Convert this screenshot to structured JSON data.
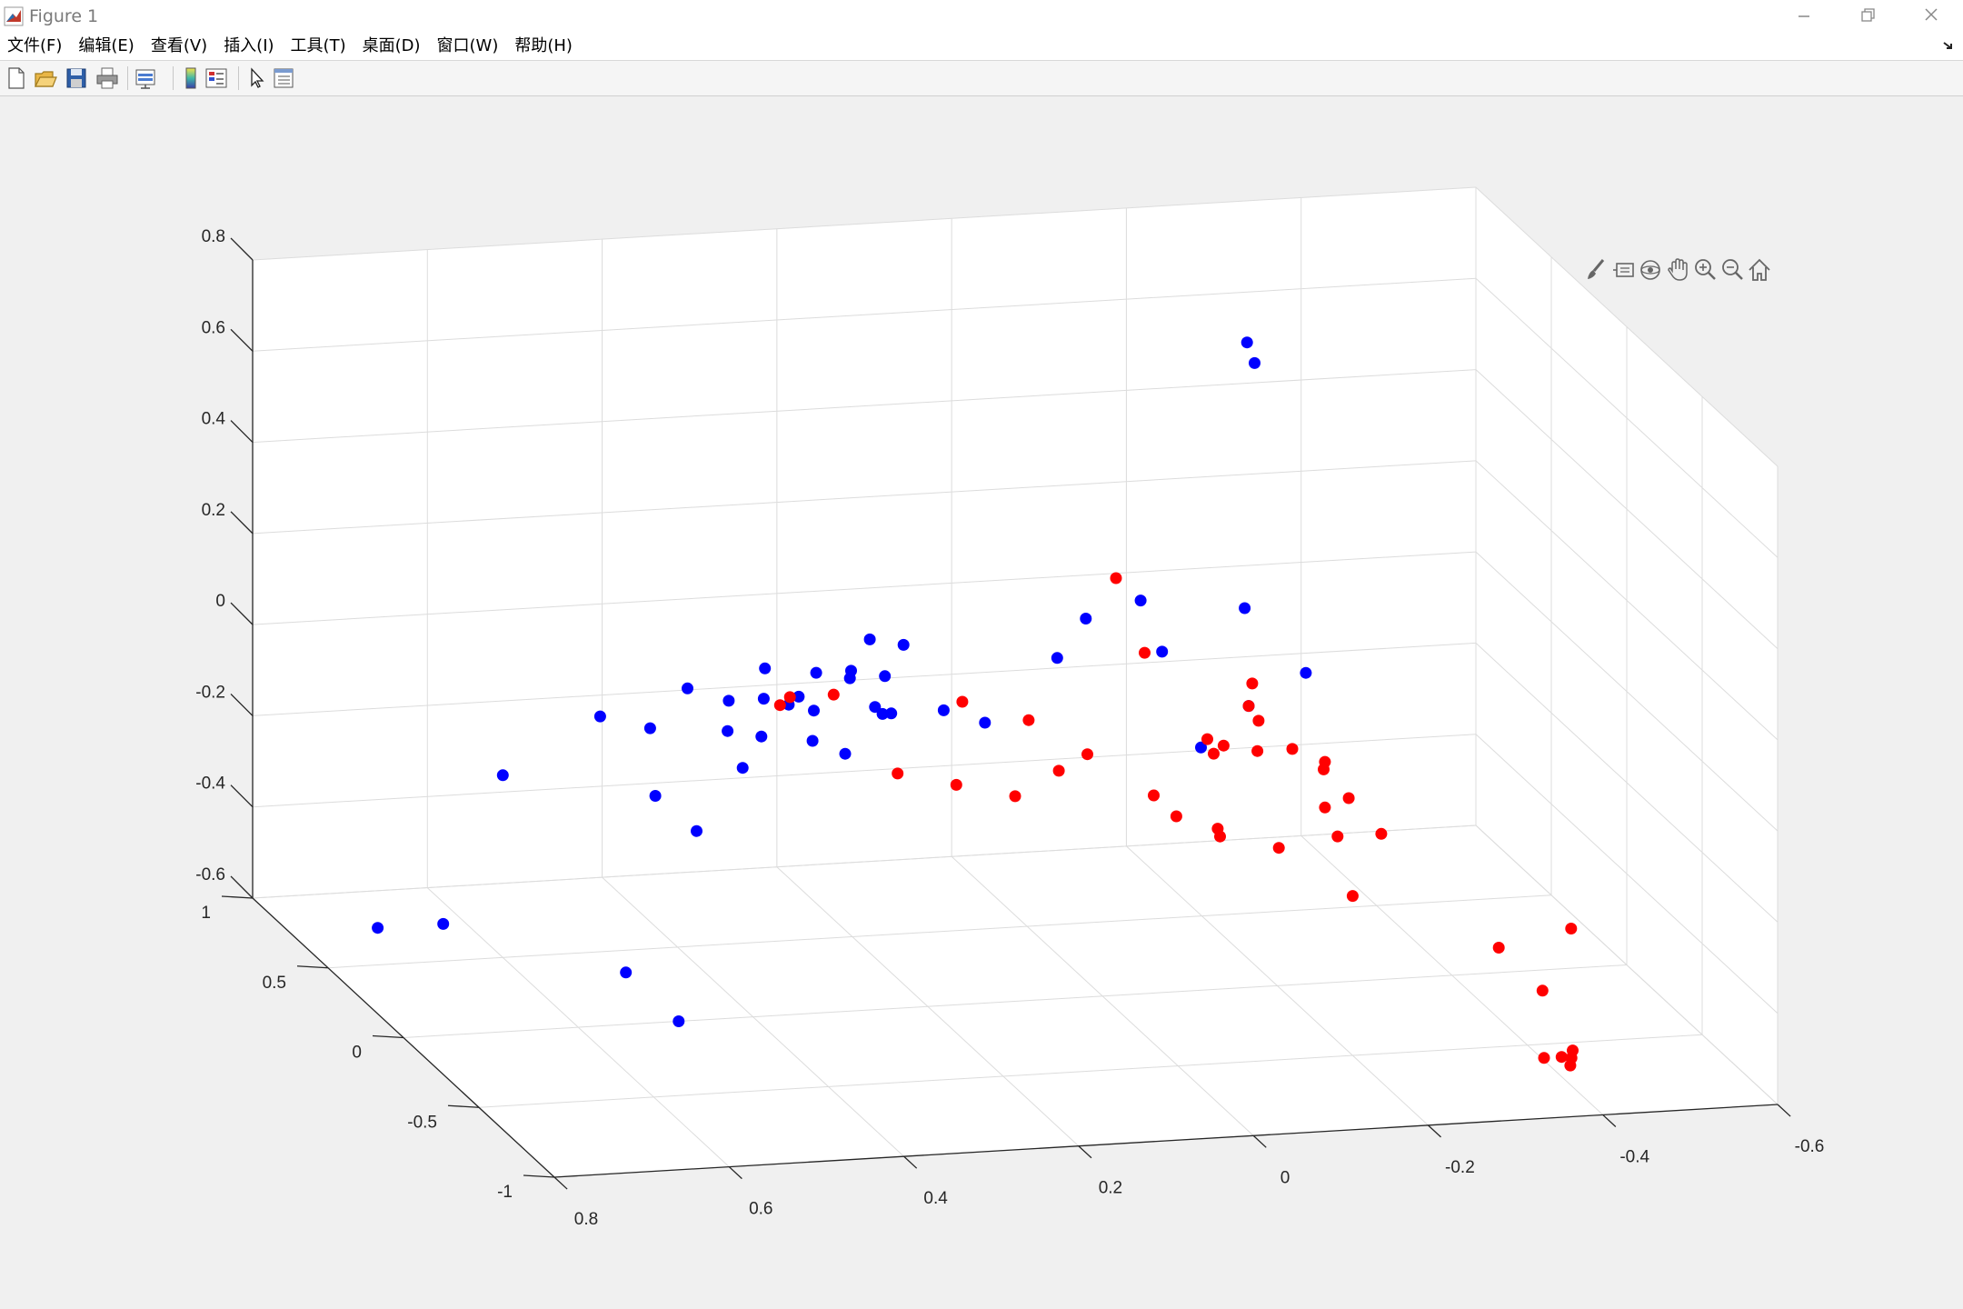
{
  "window": {
    "title": "Figure 1"
  },
  "menu": {
    "items": [
      {
        "label": "文件(F)",
        "name": "menu-file"
      },
      {
        "label": "编辑(E)",
        "name": "menu-edit"
      },
      {
        "label": "查看(V)",
        "name": "menu-view"
      },
      {
        "label": "插入(I)",
        "name": "menu-insert"
      },
      {
        "label": "工具(T)",
        "name": "menu-tools"
      },
      {
        "label": "桌面(D)",
        "name": "menu-desktop"
      },
      {
        "label": "窗口(W)",
        "name": "menu-window"
      },
      {
        "label": "帮助(H)",
        "name": "menu-help"
      }
    ]
  },
  "toolbar": {
    "icons": [
      "new-figure-icon",
      "open-file-icon",
      "save-icon",
      "print-icon",
      "link-plot-icon",
      "colorbar-icon",
      "legend-icon",
      "edit-plot-arrow-icon",
      "property-inspector-icon"
    ]
  },
  "axes_toolbar": {
    "icons": [
      "brush-icon",
      "data-tips-icon",
      "rotate-3d-icon",
      "pan-icon",
      "zoom-in-icon",
      "zoom-out-icon",
      "home-icon"
    ]
  },
  "colors": {
    "series_red": "#ff0000",
    "series_blue": "#0000ff",
    "grid": "#dcdcdc",
    "axis": "#262626"
  },
  "chart_data": {
    "type": "scatter",
    "title": "",
    "xlabel": "",
    "ylabel": "",
    "zlabel": "",
    "xlim": [
      -0.6,
      0.8
    ],
    "ylim": [
      -1,
      1
    ],
    "zlim": [
      -0.6,
      0.8
    ],
    "x_ticks": [
      "-0.6",
      "-0.4",
      "-0.2",
      "0",
      "0.2",
      "0.4",
      "0.6",
      "0.8"
    ],
    "y_ticks": [
      "-1",
      "-0.5",
      "0",
      "0.5",
      "1"
    ],
    "z_ticks": [
      "-0.6",
      "-0.4",
      "-0.2",
      "0",
      "0.2",
      "0.4",
      "0.6",
      "0.8"
    ],
    "grid": true,
    "series": [
      {
        "color": "#0000ff",
        "points": [
          [
            0.7,
            0.75,
            -0.6
          ],
          [
            0.625,
            0.75,
            -0.6
          ],
          [
            0.485,
            0.35,
            -0.6
          ],
          [
            0.485,
            0.0,
            -0.6
          ],
          [
            0.6,
            0.5,
            -0.2
          ],
          [
            0.48,
            0.55,
            -0.1
          ],
          [
            0.46,
            0.3,
            -0.2
          ],
          [
            0.44,
            0.45,
            -0.1
          ],
          [
            0.43,
            0.2,
            -0.25
          ],
          [
            0.38,
            0.55,
            -0.05
          ],
          [
            0.36,
            0.4,
            -0.1
          ],
          [
            0.36,
            0.3,
            -0.15
          ],
          [
            0.35,
            0.45,
            -0.05
          ],
          [
            0.33,
            0.35,
            -0.1
          ],
          [
            0.31,
            0.45,
            -0.05
          ],
          [
            0.3,
            0.5,
            0.0
          ],
          [
            0.29,
            0.4,
            -0.05
          ],
          [
            0.28,
            0.3,
            -0.1
          ],
          [
            0.27,
            0.35,
            -0.05
          ],
          [
            0.27,
            0.45,
            -0.05
          ],
          [
            0.26,
            0.2,
            -0.1
          ],
          [
            0.25,
            0.45,
            0.0
          ],
          [
            0.22,
            0.4,
            0.0
          ],
          [
            0.21,
            0.45,
            0.0
          ],
          [
            0.2,
            0.35,
            -0.05
          ],
          [
            0.2,
            0.3,
            -0.05
          ],
          [
            0.18,
            0.5,
            0.05
          ],
          [
            0.18,
            0.4,
            0.0
          ],
          [
            0.19,
            0.3,
            -0.05
          ],
          [
            0.15,
            0.45,
            0.05
          ],
          [
            0.13,
            0.3,
            -0.05
          ],
          [
            0.1,
            0.2,
            -0.05
          ],
          [
            0.0,
            0.3,
            0.05
          ],
          [
            -0.05,
            0.4,
            0.1
          ],
          [
            -0.13,
            0.5,
            0.1
          ],
          [
            -0.12,
            0.3,
            0.05
          ],
          [
            -0.13,
            0.1,
            -0.1
          ],
          [
            -0.18,
            0.1,
            0.2
          ],
          [
            -0.25,
            0.1,
            0.05
          ],
          [
            -0.2,
            0.2,
            0.75
          ],
          [
            -0.2,
            0.15,
            0.72
          ],
          [
            -0.15,
            -0.1,
            0.05
          ]
        ]
      },
      {
        "color": "#ff0000",
        "points": [
          [
            -0.05,
            0.2,
            0.25
          ],
          [
            -0.1,
            0.3,
            0.05
          ],
          [
            -0.18,
            0.05,
            0.05
          ],
          [
            -0.15,
            -0.1,
            0.05
          ],
          [
            -0.17,
            -0.05,
            0.0
          ],
          [
            -0.16,
            -0.1,
            -0.05
          ],
          [
            -0.13,
            -0.05,
            -0.05
          ],
          [
            -0.12,
            0.0,
            -0.05
          ],
          [
            -0.11,
            -0.1,
            -0.05
          ],
          [
            -0.2,
            -0.1,
            -0.05
          ],
          [
            -0.22,
            -0.2,
            -0.05
          ],
          [
            -0.21,
            -0.25,
            -0.05
          ],
          [
            -0.23,
            -0.3,
            -0.1
          ],
          [
            -0.22,
            -0.2,
            -0.15
          ],
          [
            -0.25,
            -0.4,
            -0.15
          ],
          [
            -0.2,
            -0.4,
            -0.15
          ],
          [
            -0.15,
            -0.3,
            -0.2
          ],
          [
            -0.05,
            -0.05,
            -0.15
          ],
          [
            -0.05,
            -0.2,
            -0.15
          ],
          [
            -0.08,
            -0.3,
            -0.15
          ],
          [
            -0.1,
            -0.2,
            -0.2
          ],
          [
            0.0,
            0.1,
            -0.1
          ],
          [
            0.05,
            0.0,
            -0.1
          ],
          [
            0.1,
            0.0,
            -0.15
          ],
          [
            0.15,
            0.1,
            -0.15
          ],
          [
            0.2,
            0.2,
            -0.15
          ],
          [
            0.3,
            0.4,
            -0.05
          ],
          [
            0.28,
            0.45,
            -0.05
          ],
          [
            0.23,
            0.45,
            -0.05
          ],
          [
            0.1,
            0.35,
            -0.05
          ],
          [
            0.05,
            0.2,
            -0.05
          ],
          [
            -0.2,
            -0.5,
            -0.25
          ],
          [
            -0.35,
            -0.6,
            -0.35
          ],
          [
            -0.4,
            -0.6,
            -0.45
          ],
          [
            -0.35,
            -0.9,
            -0.5
          ],
          [
            -0.37,
            -0.9,
            -0.5
          ],
          [
            -0.38,
            -0.9,
            -0.52
          ],
          [
            -0.39,
            -0.85,
            -0.52
          ],
          [
            -0.4,
            -0.8,
            -0.52
          ],
          [
            -0.45,
            -0.5,
            -0.35
          ]
        ]
      }
    ]
  }
}
